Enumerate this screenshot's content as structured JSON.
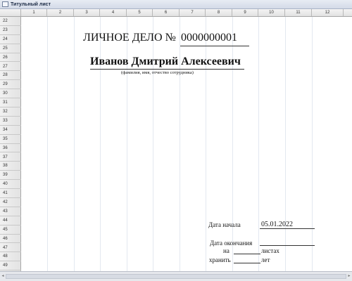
{
  "window": {
    "title": "Титульный лист"
  },
  "columns": [
    "1",
    "2",
    "3",
    "4",
    "5",
    "6",
    "7",
    "8",
    "9",
    "10",
    "11",
    "12"
  ],
  "rows": [
    "22",
    "23",
    "24",
    "25",
    "26",
    "27",
    "28",
    "29",
    "30",
    "31",
    "32",
    "33",
    "34",
    "35",
    "36",
    "37",
    "38",
    "39",
    "40",
    "41",
    "42",
    "43",
    "44",
    "45",
    "46",
    "47",
    "48",
    "49"
  ],
  "document": {
    "heading": "ЛИЧНОЕ ДЕЛО №",
    "case_number": "0000000001",
    "employee_name": "Иванов Дмитрий Алексеевич",
    "name_caption": "(фамилия, имя, отчество сотрудника)",
    "start_label": "Дата начала",
    "start_value": "05.01.2022",
    "end_label": "Дата окончания",
    "on_label": "на",
    "sheets_label": "листах",
    "keep_label": "хранить",
    "years_label": "лет"
  },
  "icons": {
    "window": "sheet-icon",
    "scroll_left": "arrow-left-icon",
    "scroll_right": "arrow-right-icon"
  }
}
